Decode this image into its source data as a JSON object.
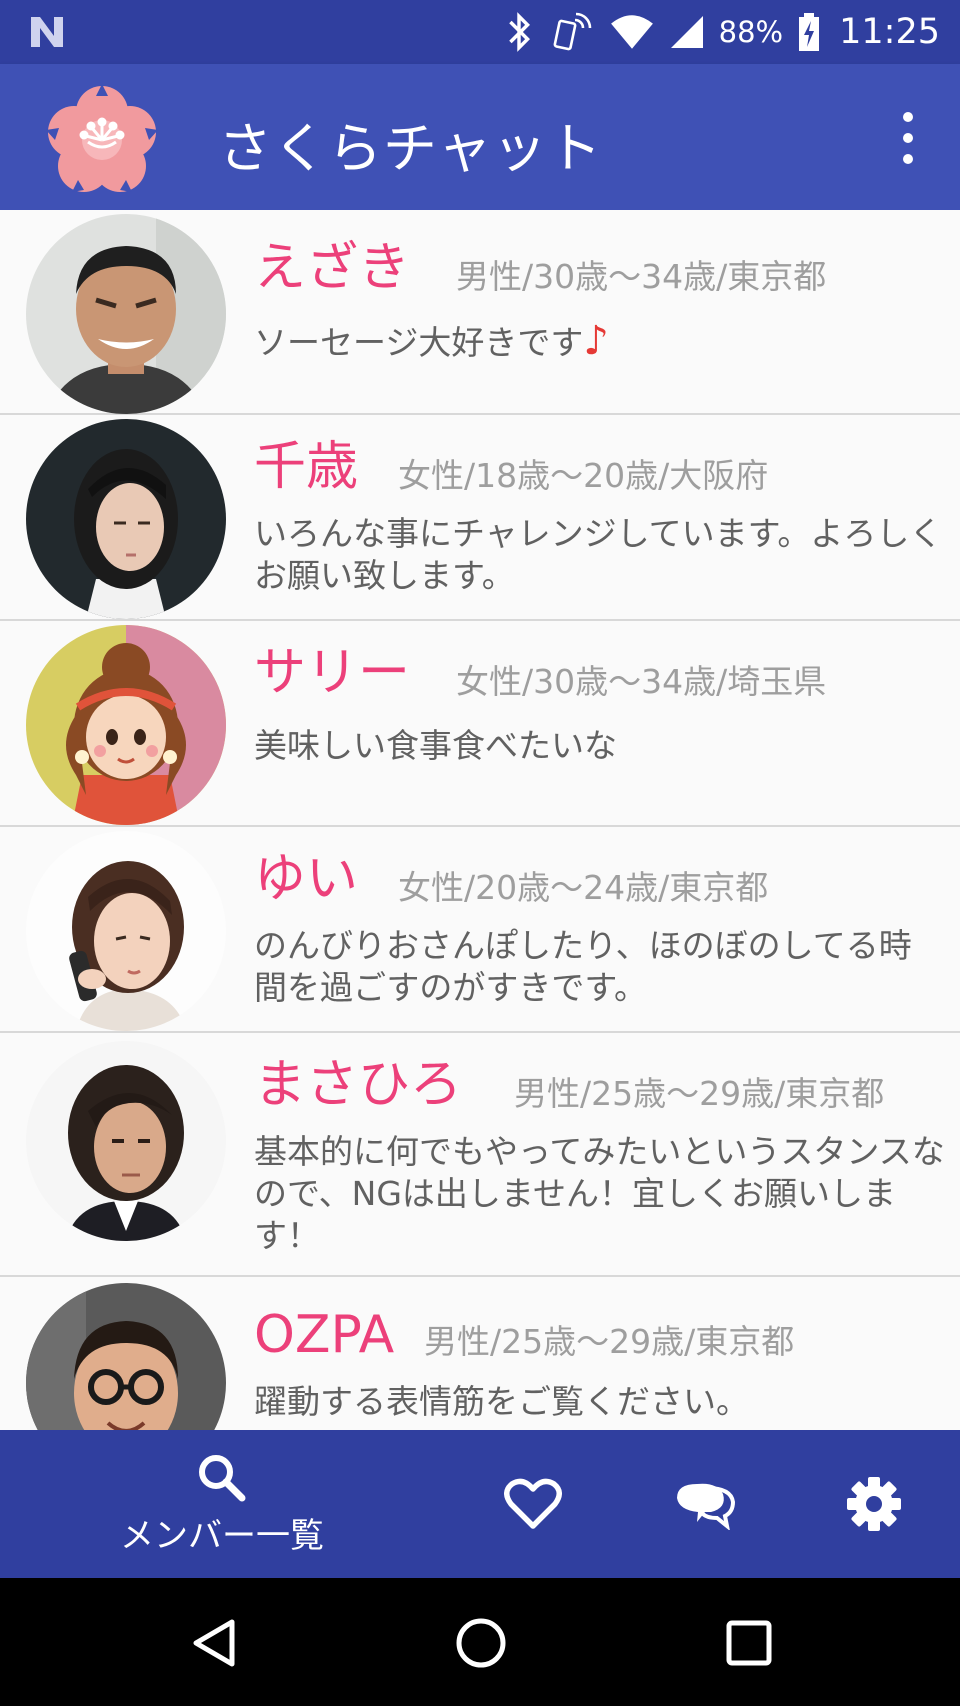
{
  "status_bar": {
    "battery": "88%",
    "time": "11:25"
  },
  "app_bar": {
    "title": "さくらチャット",
    "logo_icon": "sakura-flower-icon",
    "menu_icon": "more-vert-icon"
  },
  "members": [
    {
      "name": "えざき",
      "meta": "男性/30歳〜34歳/東京都",
      "bio": "ソーセージ大好きです",
      "bio_suffix": "♪"
    },
    {
      "name": "千歳",
      "meta": "女性/18歳〜20歳/大阪府",
      "bio": "いろんな事にチャレンジしています。よろしくお願い致します。"
    },
    {
      "name": "サリー",
      "meta": "女性/30歳〜34歳/埼玉県",
      "bio": "美味しい食事食べたいな"
    },
    {
      "name": "ゆい",
      "meta": "女性/20歳〜24歳/東京都",
      "bio": "のんびりおさんぽしたり、ほのぼのしてる時間を過ごすのがすきです。"
    },
    {
      "name": "まさひろ",
      "meta": "男性/25歳〜29歳/東京都",
      "bio": "基本的に何でもやってみたいというスタンスなので、NGは出しません！宜しくお願いします！"
    },
    {
      "name": "OZPA",
      "meta": "男性/25歳〜29歳/東京都",
      "bio": "躍動する表情筋をご覧ください。"
    }
  ],
  "bottom_nav": {
    "members_label": "メンバー一覧",
    "items": [
      "search-icon",
      "heart-icon",
      "chat-icon",
      "settings-icon"
    ]
  },
  "colors": {
    "status_bar": "#303f9f",
    "app_bar": "#3f51b5",
    "name": "#ec407a",
    "meta": "#9e9e9e",
    "bio": "#616161"
  }
}
